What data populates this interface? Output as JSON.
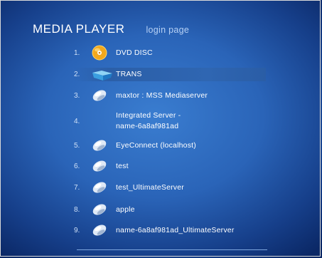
{
  "header": {
    "app_title": "MEDIA PLAYER",
    "page_title": "login page"
  },
  "items": [
    {
      "num": "1.",
      "label": "DVD DISC",
      "icon": "dvd-disc-icon"
    },
    {
      "num": "2.",
      "label": "TRANS",
      "icon": "network-folder-icon",
      "selected": true
    },
    {
      "num": "3.",
      "label": "maxtor : MSS Mediaserver",
      "icon": "media-server-icon"
    },
    {
      "num": "4.",
      "label_line1": "Integrated Server -",
      "label_line2": "name-6a8af981ad",
      "icon": ""
    },
    {
      "num": "5.",
      "label": "EyeConnect (localhost)",
      "icon": "media-server-icon"
    },
    {
      "num": "6.",
      "label": "test",
      "icon": "media-server-icon"
    },
    {
      "num": "7.",
      "label": "test_UltimateServer",
      "icon": "media-server-icon"
    },
    {
      "num": "8.",
      "label": "apple",
      "icon": "media-server-icon"
    },
    {
      "num": "9.",
      "label": "name-6a8af981ad_UltimateServer",
      "icon": "media-server-icon"
    }
  ],
  "colors": {
    "background": "#2a64b8",
    "selection": "#2f66b2",
    "disc": "#f2a81d"
  }
}
